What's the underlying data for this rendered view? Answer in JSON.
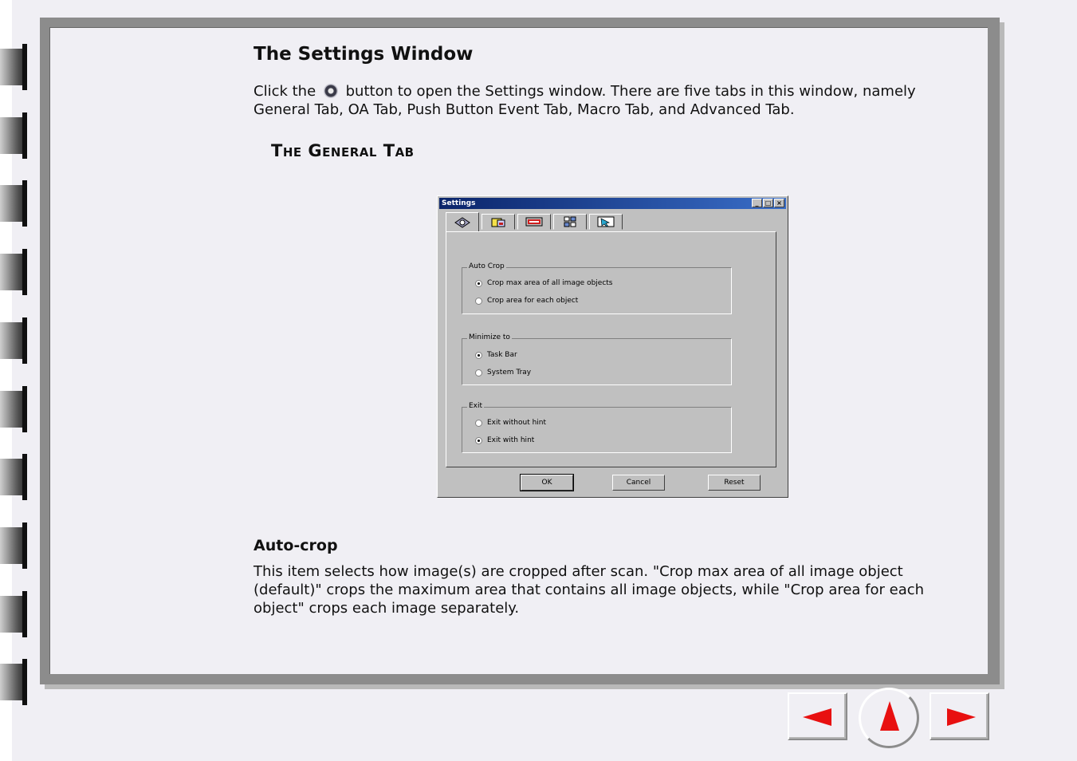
{
  "heading": "The Settings Window",
  "intro": {
    "before_icon": "Click the",
    "icon": "settings-icon",
    "after_icon": "button to open the Settings window. There are five tabs in this window, namely General Tab, OA Tab, Push Button Event Tab, Macro Tab, and Advanced Tab."
  },
  "subheading": "The General Tab",
  "dialog": {
    "title": "Settings",
    "window_buttons": [
      "_",
      "□",
      "×"
    ],
    "tabs": [
      {
        "icon": "general-tab-icon"
      },
      {
        "icon": "oa-tab-icon"
      },
      {
        "icon": "push-button-event-tab-icon"
      },
      {
        "icon": "macro-tab-icon"
      },
      {
        "icon": "advanced-tab-icon"
      }
    ],
    "groups": {
      "auto_crop": {
        "label": "Auto Crop",
        "options": [
          "Crop max area of all image objects",
          "Crop area for each object"
        ],
        "selected": 0
      },
      "minimize_to": {
        "label": "Minimize to",
        "options": [
          "Task Bar",
          "System Tray"
        ],
        "selected": 0
      },
      "exit": {
        "label": "Exit",
        "options": [
          "Exit without hint",
          "Exit with hint"
        ],
        "selected": 1
      }
    },
    "buttons": {
      "ok": "OK",
      "cancel": "Cancel",
      "reset": "Reset"
    }
  },
  "autocrop": {
    "heading": "Auto-crop",
    "body": "This item selects how image(s) are cropped after scan. \"Crop max area of all image object (default)\" crops the maximum area that contains all image objects, while \"Crop area for each object\" crops each image separately."
  },
  "nav": {
    "prev_icon": "left-arrow-icon",
    "up_icon": "up-arrow-icon",
    "next_icon": "right-arrow-icon",
    "arrow_color": "#e81010"
  }
}
